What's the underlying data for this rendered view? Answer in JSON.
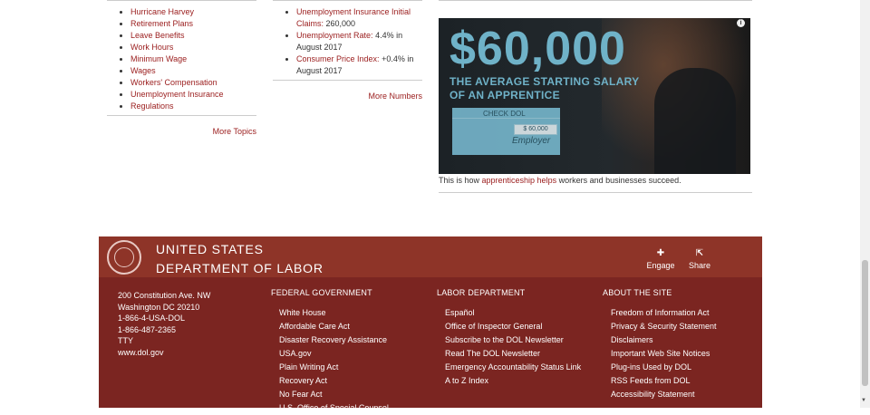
{
  "topics": {
    "items": [
      "Hurricane Harvey",
      "Retirement Plans",
      "Leave Benefits",
      "Work Hours",
      "Minimum Wage",
      "Wages",
      "Workers' Compensation",
      "Unemployment Insurance",
      "Regulations"
    ],
    "more_label": "More Topics"
  },
  "numbers": {
    "items": [
      {
        "link": "Unemployment Insurance Initial Claims:",
        "value": "260,000"
      },
      {
        "link": "Unemployment Rate:",
        "value": "4.4% in August 2017"
      },
      {
        "link": "Consumer Price Index:",
        "value": "+0.4% in August 2017"
      }
    ],
    "more_label": "More Numbers"
  },
  "promo": {
    "amount": "$60,000",
    "line1": "THE AVERAGE STARTING SALARY",
    "line2": "OF AN APPRENTICE",
    "check_title": "CHECK DOL",
    "check_amount": "$ 60,000",
    "check_signature": "Employer",
    "info_icon": "i",
    "caption_pre": "This is how ",
    "caption_link": "apprenticeship helps",
    "caption_post": " workers and businesses succeed."
  },
  "footer": {
    "agency_line1": "UNITED STATES",
    "agency_line2": "DEPARTMENT OF LABOR",
    "engage_label": "Engage",
    "share_label": "Share",
    "address": [
      "200 Constitution Ave. NW",
      "Washington DC 20210",
      "1-866-4-USA-DOL",
      "1-866-487-2365",
      "TTY",
      "www.dol.gov"
    ],
    "federal": {
      "heading": "FEDERAL GOVERNMENT",
      "links": [
        "White House",
        "Affordable Care Act",
        "Disaster Recovery Assistance",
        "USA.gov",
        "Plain Writing Act",
        "Recovery Act",
        "No Fear Act",
        "U.S. Office of Special Counsel"
      ]
    },
    "labor": {
      "heading": "LABOR DEPARTMENT",
      "links": [
        "Español",
        "Office of Inspector General",
        "Subscribe to the DOL Newsletter",
        "Read The DOL Newsletter",
        "Emergency Accountability Status Link",
        "A to Z Index"
      ]
    },
    "about": {
      "heading": "ABOUT THE SITE",
      "links": [
        "Freedom of Information Act",
        "Privacy & Security Statement",
        "Disclaimers",
        "Important Web Site Notices",
        "Plug-ins Used by DOL",
        "RSS Feeds from DOL",
        "Accessibility Statement"
      ]
    }
  },
  "colors": {
    "link": "#9a1c1c",
    "footer_bg": "#7b2521",
    "footer_head_bg": "#8e3428",
    "promo_accent": "#6fb2c8"
  },
  "icons": {
    "engage": "plus-icon",
    "share": "share-icon",
    "seal": "dol-seal-icon"
  }
}
